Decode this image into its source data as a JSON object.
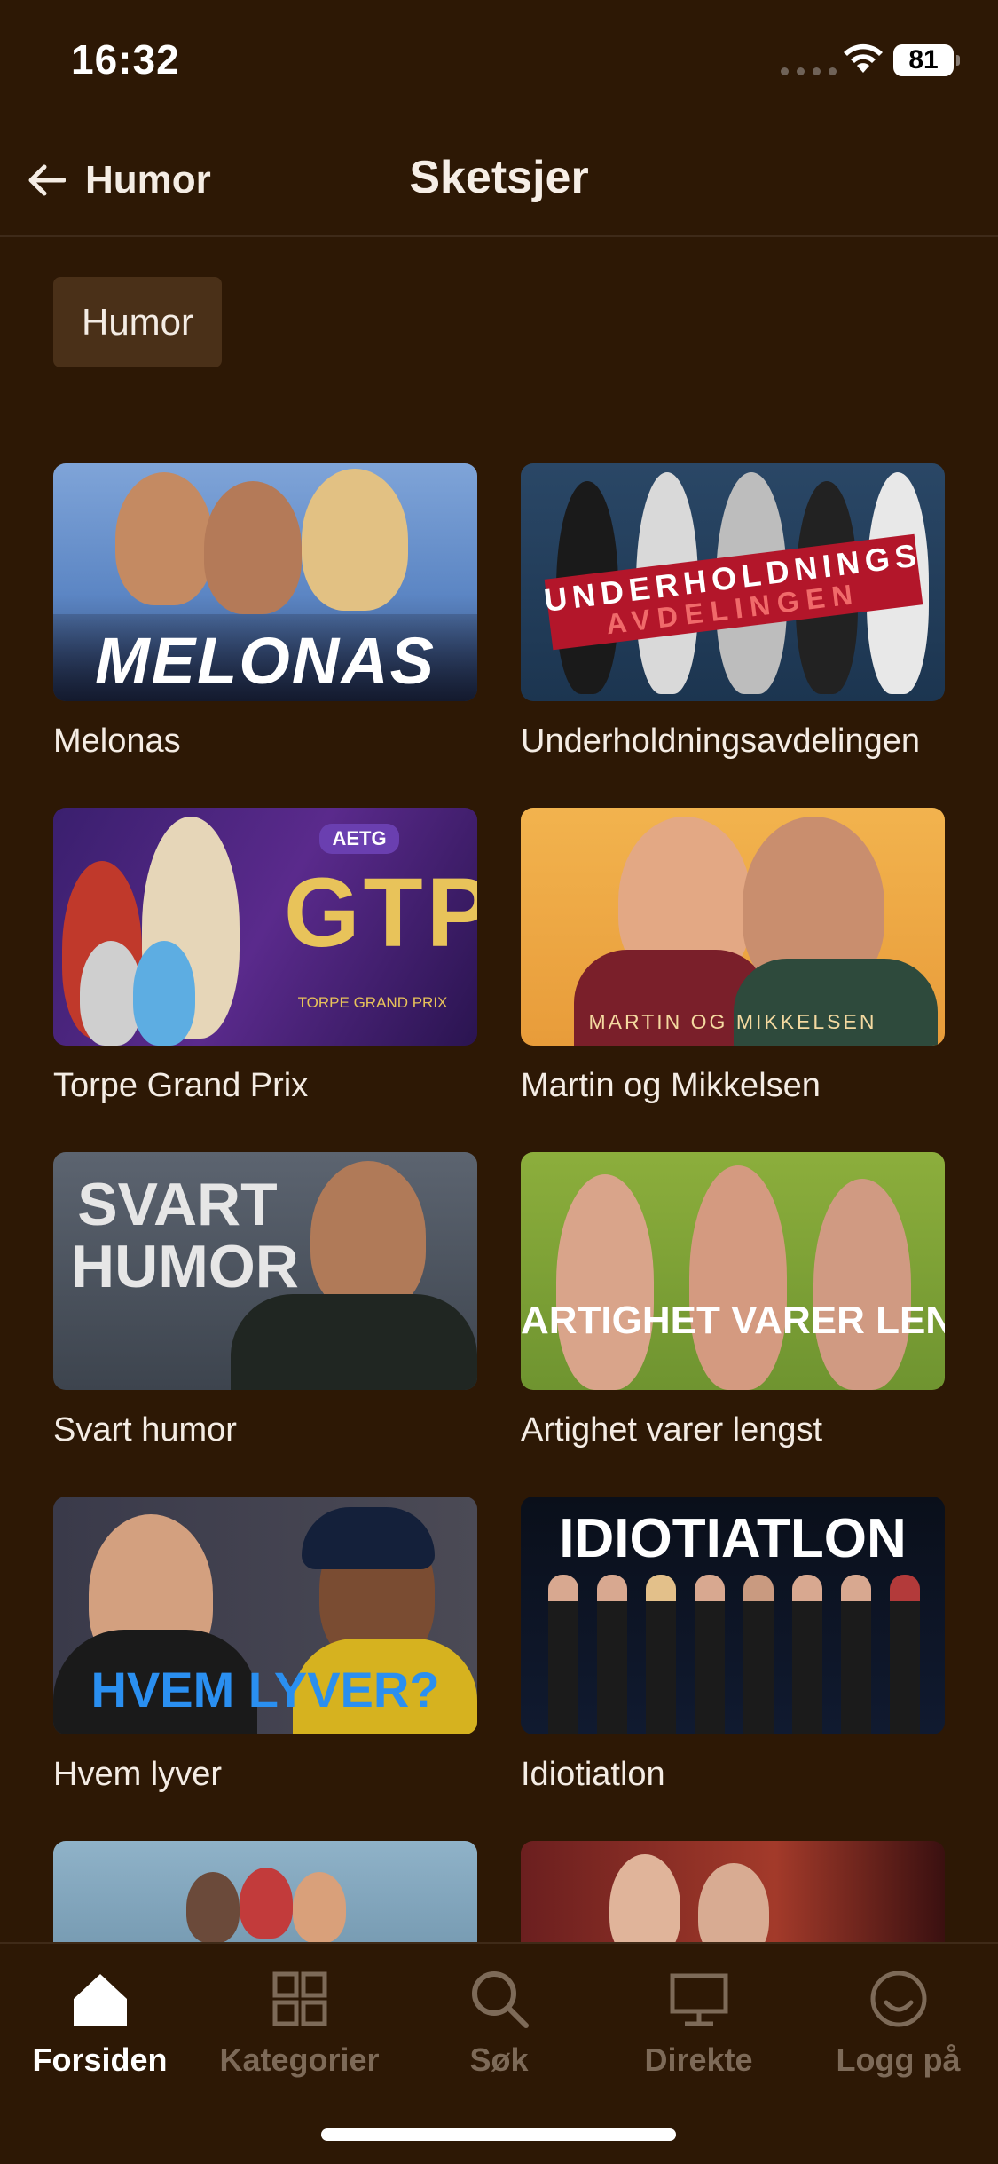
{
  "status": {
    "time": "16:32",
    "battery": "81"
  },
  "header": {
    "back_label": "Humor",
    "title": "Sketsjer"
  },
  "filter": {
    "chip_label": "Humor"
  },
  "shows": [
    {
      "title": "Melonas",
      "thumb_text": "MELONAS"
    },
    {
      "title": "Underholdningsavdelingen",
      "thumb_text_line1": "UNDERHOLDNINGS",
      "thumb_text_line2": "AVDELINGEN"
    },
    {
      "title": "Torpe Grand Prix",
      "thumb_text": "GTP",
      "thumb_sub": "TORPE GRAND PRIX",
      "thumb_badge": "AETG"
    },
    {
      "title": "Martin og Mikkelsen",
      "thumb_text": "MARTIN OG MIKKELSEN"
    },
    {
      "title": "Svart humor",
      "thumb_text_line1": "SVART",
      "thumb_text_line2": "HUMOR"
    },
    {
      "title": "Artighet varer lengst",
      "thumb_text": "ARTIGHET VARER LENGST"
    },
    {
      "title": "Hvem lyver",
      "thumb_text": "HVEM LYVER?"
    },
    {
      "title": "Idiotiatlon",
      "thumb_text": "IDIOTIATLON"
    },
    {
      "title": ""
    },
    {
      "title": ""
    }
  ],
  "nav": {
    "items": [
      {
        "label": "Forsiden",
        "icon": "home-icon",
        "active": true
      },
      {
        "label": "Kategorier",
        "icon": "grid-icon",
        "active": false
      },
      {
        "label": "Søk",
        "icon": "search-icon",
        "active": false
      },
      {
        "label": "Direkte",
        "icon": "tv-icon",
        "active": false
      },
      {
        "label": "Logg på",
        "icon": "profile-icon",
        "active": false
      }
    ]
  },
  "colors": {
    "background": "#2d1805",
    "chip": "#4a3018",
    "nav_inactive": "#7d6a58",
    "nav_active": "#ffffff"
  }
}
